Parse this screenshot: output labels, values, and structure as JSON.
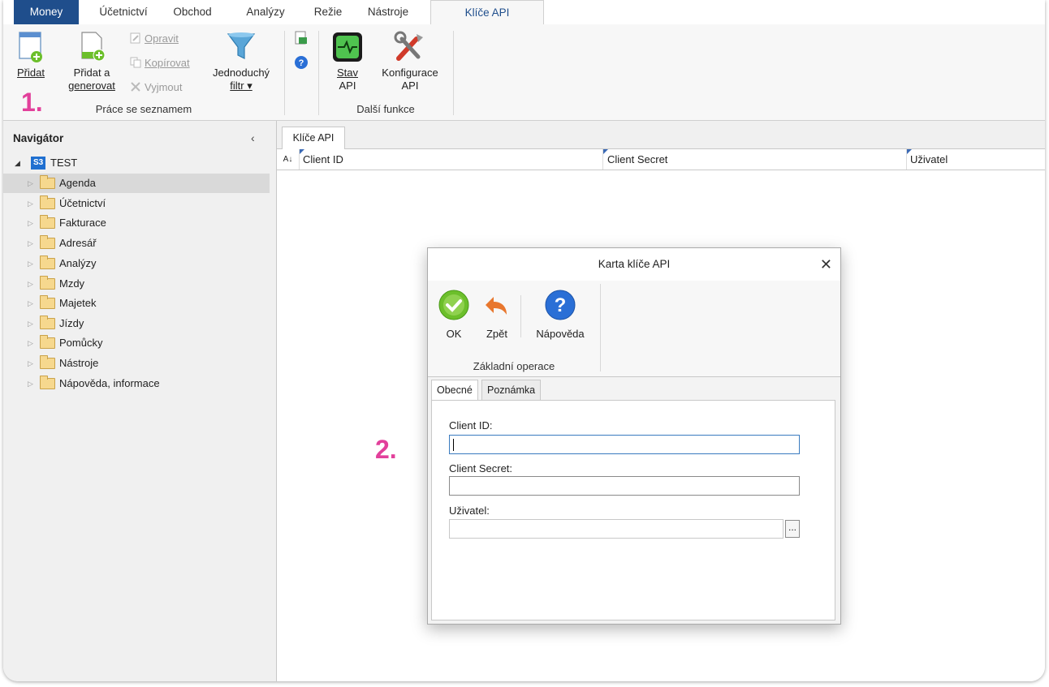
{
  "menu": {
    "tabs": [
      "Money",
      "Účetnictví",
      "Obchod",
      "Analýzy",
      "Režie",
      "Nástroje",
      "Klíče API"
    ]
  },
  "ribbon": {
    "add_label": "Přidat",
    "add_generate_line1": "Přidat a",
    "add_generate_line2": "generovat",
    "edit_label": "Opravit",
    "copy_label": "Kopírovat",
    "cut_label": "Vyjmout",
    "filter_line1": "Jednoduchý",
    "filter_line2": "filtr ▾",
    "group1_label": "Práce se seznamem",
    "status_line1": "Stav",
    "status_line2": "API",
    "config_line1": "Konfigurace",
    "config_line2": "API",
    "group2_label": "Další funkce"
  },
  "navigator": {
    "title": "Navigátor",
    "collapse_glyph": "‹",
    "root_badge": "S3",
    "root_label": "TEST",
    "items": [
      "Agenda",
      "Účetnictví",
      "Fakturace",
      "Adresář",
      "Analýzy",
      "Mzdy",
      "Majetek",
      "Jízdy",
      "Pomůcky",
      "Nástroje",
      "Nápověda, informace"
    ],
    "selected": "Agenda"
  },
  "main": {
    "tab_label": "Klíče API",
    "sort_glyph": "A↓",
    "columns": [
      "Client ID",
      "Client Secret",
      "Uživatel"
    ]
  },
  "steps": {
    "one": "1.",
    "two": "2."
  },
  "dialog": {
    "title": "Karta klíče API",
    "close_glyph": "✕",
    "ok_label": "OK",
    "back_label": "Zpět",
    "help_label": "Nápověda",
    "group_label": "Základní operace",
    "tabs": [
      "Obecné",
      "Poznámka"
    ],
    "fields": {
      "client_id_label": "Client ID:",
      "client_id_value": "",
      "client_secret_label": "Client Secret:",
      "client_secret_value": "",
      "user_label": "Uživatel:",
      "user_value": "",
      "ellipsis": "..."
    }
  },
  "colors": {
    "brand": "#1f4e8c",
    "step": "#e2409b",
    "ok_green": "#6cbf2b",
    "help_blue": "#2a6fd6"
  }
}
